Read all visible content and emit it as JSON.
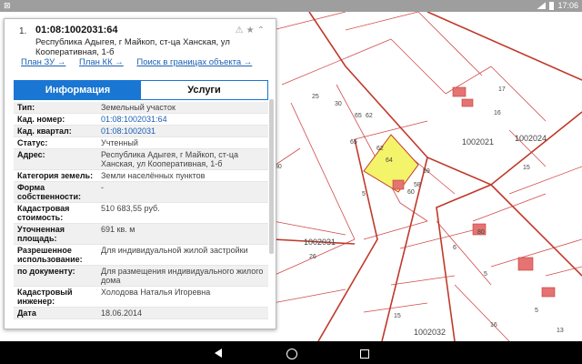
{
  "status_bar": {
    "left_text": "⊠",
    "time": "17:06"
  },
  "panel": {
    "result_number": "1.",
    "cadastral_number": "01:08:1002031:64",
    "address": "Республика Адыгея, г Майкоп, ст-ца Ханская, ул Кооперативная, 1-б",
    "links": [
      "План ЗУ →",
      "План КК →",
      "Поиск в границах объекта →"
    ],
    "tabs": [
      "Информация",
      "Услуги"
    ],
    "rows": [
      {
        "key": "Тип:",
        "value": "Земельный участок",
        "link": false
      },
      {
        "key": "Кад. номер:",
        "value": "01:08:1002031:64",
        "link": true
      },
      {
        "key": "Кад. квартал:",
        "value": "01:08:1002031",
        "link": true
      },
      {
        "key": "Статус:",
        "value": "Учтенный",
        "link": false
      },
      {
        "key": "Адрес:",
        "value": "Республика Адыгея, г Майкоп, ст-ца Ханская, ул Кооперативная, 1-б",
        "link": false
      },
      {
        "key": "Категория земель:",
        "value": "Земли населённых пунктов",
        "link": false
      },
      {
        "key": "Форма собственности:",
        "value": "-",
        "link": false
      },
      {
        "key": "Кадастровая стоимость:",
        "value": "510 683,55 руб.",
        "link": false
      },
      {
        "key": "Уточненная площадь:",
        "value": "691 кв. м",
        "link": false
      },
      {
        "key": "Разрешенное использование:",
        "value": "Для индивидуальной жилой застройки",
        "link": false
      },
      {
        "key": "по документу:",
        "value": "Для размещения индивидуального жилого дома",
        "link": false
      },
      {
        "key": "Кадастровый инженер:",
        "value": "Холодова Наталья Игоревна",
        "link": false
      },
      {
        "key": "Дата",
        "value": "18.06.2014",
        "link": false
      }
    ]
  },
  "map": {
    "labels": [
      "25",
      "30",
      "65",
      "62",
      "65",
      "62",
      "64",
      "59",
      "58",
      "60",
      "5",
      "17",
      "16",
      "1002021",
      "1002024",
      "15",
      "30",
      "1002031",
      "26",
      "6",
      "5",
      "80",
      "5",
      "15",
      "1002032",
      "16",
      "13"
    ],
    "highlight_color": "#f4f46a",
    "boundary_color": "#c0392b"
  }
}
